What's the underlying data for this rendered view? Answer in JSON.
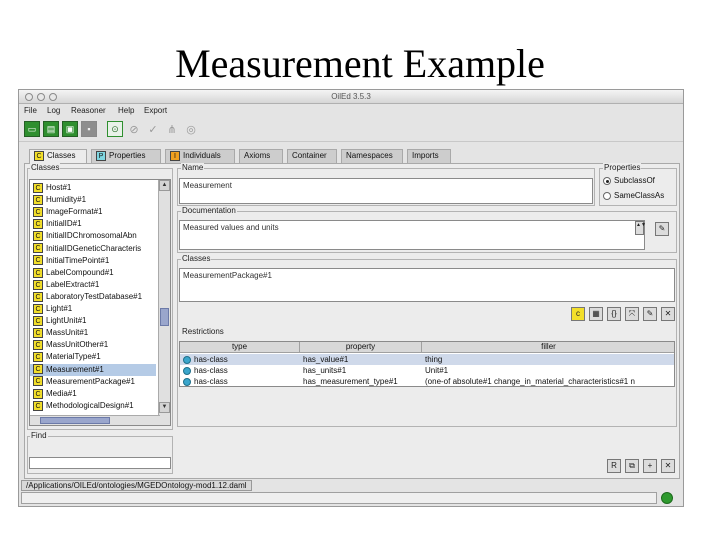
{
  "slide": {
    "title": "Measurement Example"
  },
  "window": {
    "title": "OilEd 3.5.3"
  },
  "menu": [
    "File",
    "Log",
    "Reasoner",
    "Help",
    "Export"
  ],
  "tabs": [
    {
      "label": "Classes",
      "badge": "C",
      "badge_color": "#f3df2a",
      "active": true
    },
    {
      "label": "Properties",
      "badge": "P",
      "badge_color": "#7fd6e0",
      "active": false
    },
    {
      "label": "Individuals",
      "badge": "I",
      "badge_color": "#f0a020",
      "active": false
    },
    {
      "label": "Axioms",
      "active": false
    },
    {
      "label": "Container",
      "active": false
    },
    {
      "label": "Namespaces",
      "active": false
    },
    {
      "label": "Imports",
      "active": false
    }
  ],
  "classes_panel": {
    "label": "Classes",
    "items": [
      "Host#1",
      "Humidity#1",
      "ImageFormat#1",
      "InitialID#1",
      "InitialIDChromosomalAbn",
      "InitialIDGeneticCharacteris",
      "InitialTimePoint#1",
      "LabelCompound#1",
      "LabelExtract#1",
      "LaboratoryTestDatabase#1",
      "Light#1",
      "LightUnit#1",
      "MassUnit#1",
      "MassUnitOther#1",
      "MaterialType#1",
      "Measurement#1",
      "MeasurementPackage#1",
      "Media#1",
      "MethodologicalDesign#1"
    ],
    "selected": "Measurement#1",
    "find_label": "Find"
  },
  "name": {
    "label": "Name",
    "value": "Measurement"
  },
  "properties_group": {
    "label": "Properties",
    "options": [
      "SubclassOf",
      "SameClassAs"
    ],
    "selected": "SubclassOf"
  },
  "documentation": {
    "label": "Documentation",
    "value": "Measured values and units"
  },
  "superclasses": {
    "label": "Classes",
    "value": "MeasurementPackage#1"
  },
  "restrictions": {
    "label": "Restrictions",
    "columns": [
      "type",
      "property",
      "filler"
    ],
    "rows": [
      {
        "type": "has-class",
        "property": "has_value#1",
        "filler": "thing"
      },
      {
        "type": "has-class",
        "property": "has_units#1",
        "filler": "Unit#1"
      },
      {
        "type": "has-class",
        "property": "has_measurement_type#1",
        "filler": "(one-of absolute#1 change_in_material_characteristics#1 n"
      }
    ]
  },
  "status": {
    "path": "/Applications/OILEd/ontologies/MGEDOntology-mod1.12.daml"
  }
}
